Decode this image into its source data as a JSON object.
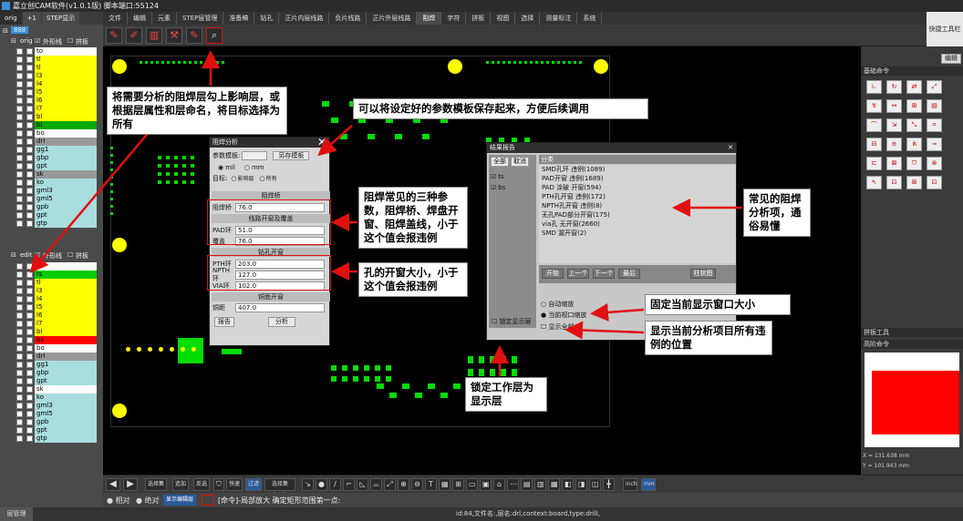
{
  "window": {
    "title": "嘉立创CAM软件(v1.0.1版) 脚本端口:55124"
  },
  "left_tabs": [
    "orig",
    "+1",
    "STEP显示"
  ],
  "menu": [
    "文件",
    "编辑",
    "元素",
    "STEP层管理",
    "准备稿",
    "钻孔",
    "正片内层线路",
    "负片线路",
    "正片外层线路",
    "阻焊",
    "字符",
    "拼板",
    "视图",
    "选择",
    "测量标注",
    "系统"
  ],
  "menu_active": "阻焊",
  "quick_tools": "快捷工具栏",
  "layers_panel": {
    "root": "888",
    "orig_label": "orig",
    "outline_label": "外形线",
    "panel_label": "拼板",
    "orig_layers": [
      {
        "name": "to",
        "color": "#ffffff"
      },
      {
        "name": "tl",
        "color": "#ffff00"
      },
      {
        "name": "tl",
        "color": "#ffff00"
      },
      {
        "name": "l3",
        "color": "#ffff00"
      },
      {
        "name": "l4",
        "color": "#ffff00"
      },
      {
        "name": "l5",
        "color": "#ffff00"
      },
      {
        "name": "l6",
        "color": "#ffff00"
      },
      {
        "name": "l7",
        "color": "#ffff00"
      },
      {
        "name": "bl",
        "color": "#ffff00"
      },
      {
        "name": "bl",
        "color": "#00aa00"
      },
      {
        "name": "bo",
        "color": "#ffffff"
      },
      {
        "name": "drl",
        "color": "#999999"
      },
      {
        "name": "gg1",
        "color": "#aadddd"
      },
      {
        "name": "gbp",
        "color": "#aadddd"
      },
      {
        "name": "gpt",
        "color": "#aadddd"
      },
      {
        "name": "sk",
        "color": "#999999"
      },
      {
        "name": "ko",
        "color": "#aadddd"
      },
      {
        "name": "gml3",
        "color": "#aadddd"
      },
      {
        "name": "gml5",
        "color": "#aadddd"
      },
      {
        "name": "gpb",
        "color": "#aadddd"
      },
      {
        "name": "gpt",
        "color": "#aadddd"
      },
      {
        "name": "gtp",
        "color": "#aadddd"
      }
    ],
    "edit_label": "edit",
    "edit_layers": [
      {
        "name": "to",
        "color": "#ffffff"
      },
      {
        "name": "ts",
        "color": "#00cc00"
      },
      {
        "name": "tl",
        "color": "#ffff00"
      },
      {
        "name": "l3",
        "color": "#ffff00"
      },
      {
        "name": "l4",
        "color": "#ffff00"
      },
      {
        "name": "l5",
        "color": "#ffff00"
      },
      {
        "name": "l6",
        "color": "#ffff00"
      },
      {
        "name": "l7",
        "color": "#ffff00"
      },
      {
        "name": "bl",
        "color": "#ffff00"
      },
      {
        "name": "bs",
        "color": "#ff0000"
      },
      {
        "name": "bo",
        "color": "#ffffff"
      },
      {
        "name": "drl",
        "color": "#999999"
      },
      {
        "name": "gg1",
        "color": "#aadddd"
      },
      {
        "name": "gbp",
        "color": "#aadddd"
      },
      {
        "name": "gpt",
        "color": "#aadddd"
      },
      {
        "name": "sk",
        "color": "#ffffff"
      },
      {
        "name": "ko",
        "color": "#aadddd"
      },
      {
        "name": "gml3",
        "color": "#aadddd"
      },
      {
        "name": "gml5",
        "color": "#aadddd"
      },
      {
        "name": "gpb",
        "color": "#aadddd"
      },
      {
        "name": "gpt",
        "color": "#aadddd"
      },
      {
        "name": "gtp",
        "color": "#aadddd"
      }
    ],
    "layer_manage": "层管理"
  },
  "right_panel": {
    "edit": "编辑",
    "basic_cmds": "基础命令",
    "panel_tools": "拼板工具",
    "advanced_cmds": "高阶命令",
    "coord_x": "X = 131.638 mm",
    "coord_y": "Y = 101.943 mm"
  },
  "solder_dialog": {
    "title": "阻焊分析",
    "template_label": "参数模板:",
    "save_template": "另存模板",
    "unit_mil": "mil",
    "unit_mm": "mm",
    "target_label": "目标:",
    "target_affected": "影响层",
    "target_all": "所有",
    "sec_bridge": "阻焊桥",
    "bridge_label": "阻焊桥",
    "bridge_value": "76.0",
    "sec_line": "线路开窗及覆盖",
    "pad_label": "PAD环",
    "pad_value": "51.0",
    "cover_label": "覆盖",
    "cover_value": "76.0",
    "sec_drill": "钻孔开窗",
    "pth_label": "PTH环",
    "pth_value": "203.0",
    "npth_label": "NPTH环",
    "npth_value": "127.0",
    "via_label": "VIA环",
    "via_value": "102.0",
    "sec_copper": "铜面开窗",
    "copper_label": "铜距",
    "copper_value": "407.0",
    "report_btn": "报告",
    "analyze_btn": "分析"
  },
  "result_dialog": {
    "title": "结果报告",
    "all_btn": "全部",
    "cancel_btn": "取消",
    "layers": [
      "ts",
      "bs"
    ],
    "category_header": "分类",
    "items": [
      "SMD孔环 违例(1089)",
      "PAD开窗 违例(1689)",
      "PAD 涂破 开窗(594)",
      "PTH孔开窗 违例(172)",
      "NPTH孔开窗 违例(8)",
      "无孔PAD部分开窗(175)",
      "via孔 无开窗(2660)",
      "SMD 漏开窗(2)"
    ],
    "nav_buttons": [
      "开始",
      "上一个",
      "下一个",
      "最后"
    ],
    "chart_btn": "柱状图",
    "lock_layer": "锁定显示层",
    "auto_zoom": "自动缩放",
    "current_view": "当前视口缩放",
    "show_all": "显示全部"
  },
  "callouts": {
    "c1": "将需要分析的阻焊层勾上影响层，或根据层属性和层命名，将目标选择为所有",
    "c2": "可以将设定好的参数模板保存起来，方便后续调用",
    "c3": "阻焊常见的三种参数，阻焊桥、焊盘开窗、阻焊盖线，小于这个值会报违例",
    "c4": "孔的开窗大小，小于这个值会报违例",
    "c5": "常见的阻焊分析项，通俗易懂",
    "c6": "固定当前显示窗口大小",
    "c7": "显示当前分析项目所有违例的位置",
    "c8": "锁定工作层为显示层"
  },
  "bottom_bar": {
    "select_btn": "选择集",
    "add_btn": "追加",
    "invert_btn": "反选",
    "quick_btn": "快速",
    "filter_btn": "过滤",
    "dcode_btn": "选择集dcode",
    "inch": "inch",
    "mm": "mm"
  },
  "status_row": {
    "relative": "相对",
    "absolute": "绝对",
    "display_mode": "显示编辑层",
    "command": "[命令]-局部放大 确定矩形范围第一点:"
  },
  "status_bar": "id:84,文件名:,层名:drl,context:board,type:drill,",
  "colors": {
    "accent": "#3a8fd8",
    "annotation": "#e01010"
  }
}
